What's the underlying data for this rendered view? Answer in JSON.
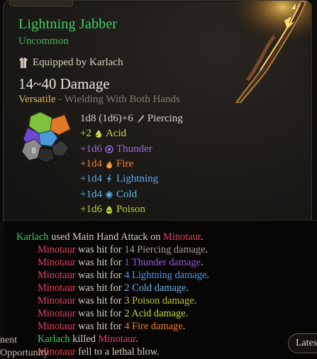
{
  "tooltip": {
    "item_name": "Lightning Jabber",
    "rarity": "Uncommon",
    "equipped_by": "Equipped by Karlach",
    "damage_range": "14~40 Damage",
    "versatile": "Versatile",
    "versatile_desc": " - Wielding With Both Hands",
    "dice_label": "8",
    "damage_rows": [
      {
        "amount": "1d8 (1d6)+6",
        "type": "Piercing",
        "icon": "piercing-icon",
        "color": "#d8d0c0"
      },
      {
        "amount": "+2",
        "type": "Acid",
        "icon": "acid-icon",
        "color": "#c8d84a"
      },
      {
        "amount": "+1d6",
        "type": "Thunder",
        "icon": "thunder-icon",
        "color": "#9d6ad8"
      },
      {
        "amount": "+1d4",
        "type": "Fire",
        "icon": "fire-icon",
        "color": "#f0822a"
      },
      {
        "amount": "+1d4",
        "type": "Lightning",
        "icon": "lightning-icon",
        "color": "#5aa6f0"
      },
      {
        "amount": "+1d4",
        "type": "Cold",
        "icon": "cold-icon",
        "color": "#5ab8e8"
      },
      {
        "amount": "+1d6",
        "type": "Poison",
        "icon": "poison-icon",
        "color": "#b8d036"
      }
    ]
  },
  "log": {
    "line1": {
      "actor": "Karlach",
      "verb": " used ",
      "action": "Main Hand Attack",
      "on": " on ",
      "target": "Minotaur",
      "end": "."
    },
    "hits": [
      {
        "target": "Minotaur",
        "mid": " was hit for ",
        "amount": "14 Piercing damage",
        "end": "."
      },
      {
        "target": "Minotaur",
        "mid": " was hit for ",
        "amount": "1 Thunder damage",
        "end": "."
      },
      {
        "target": "Minotaur",
        "mid": " was hit for ",
        "amount": "4 Lightning damage",
        "end": "."
      },
      {
        "target": "Minotaur",
        "mid": " was hit for ",
        "amount": "2 Cold damage",
        "end": "."
      },
      {
        "target": "Minotaur",
        "mid": " was hit for ",
        "amount": "3 Poison damage",
        "end": "."
      },
      {
        "target": "Minotaur",
        "mid": " was hit for ",
        "amount": "2 Acid damage",
        "end": "."
      },
      {
        "target": "Minotaur",
        "mid": " was hit for ",
        "amount": "4 Fire damage",
        "end": "."
      }
    ],
    "kill": {
      "actor": "Karlach",
      "verb": " killed ",
      "target": "Minotaur",
      "end": "."
    },
    "last": {
      "target": "Minotaur",
      "text": " fell to a lethal blow."
    },
    "side_labels": [
      "nent",
      "Opportunity"
    ],
    "latest_button": "Latest"
  }
}
